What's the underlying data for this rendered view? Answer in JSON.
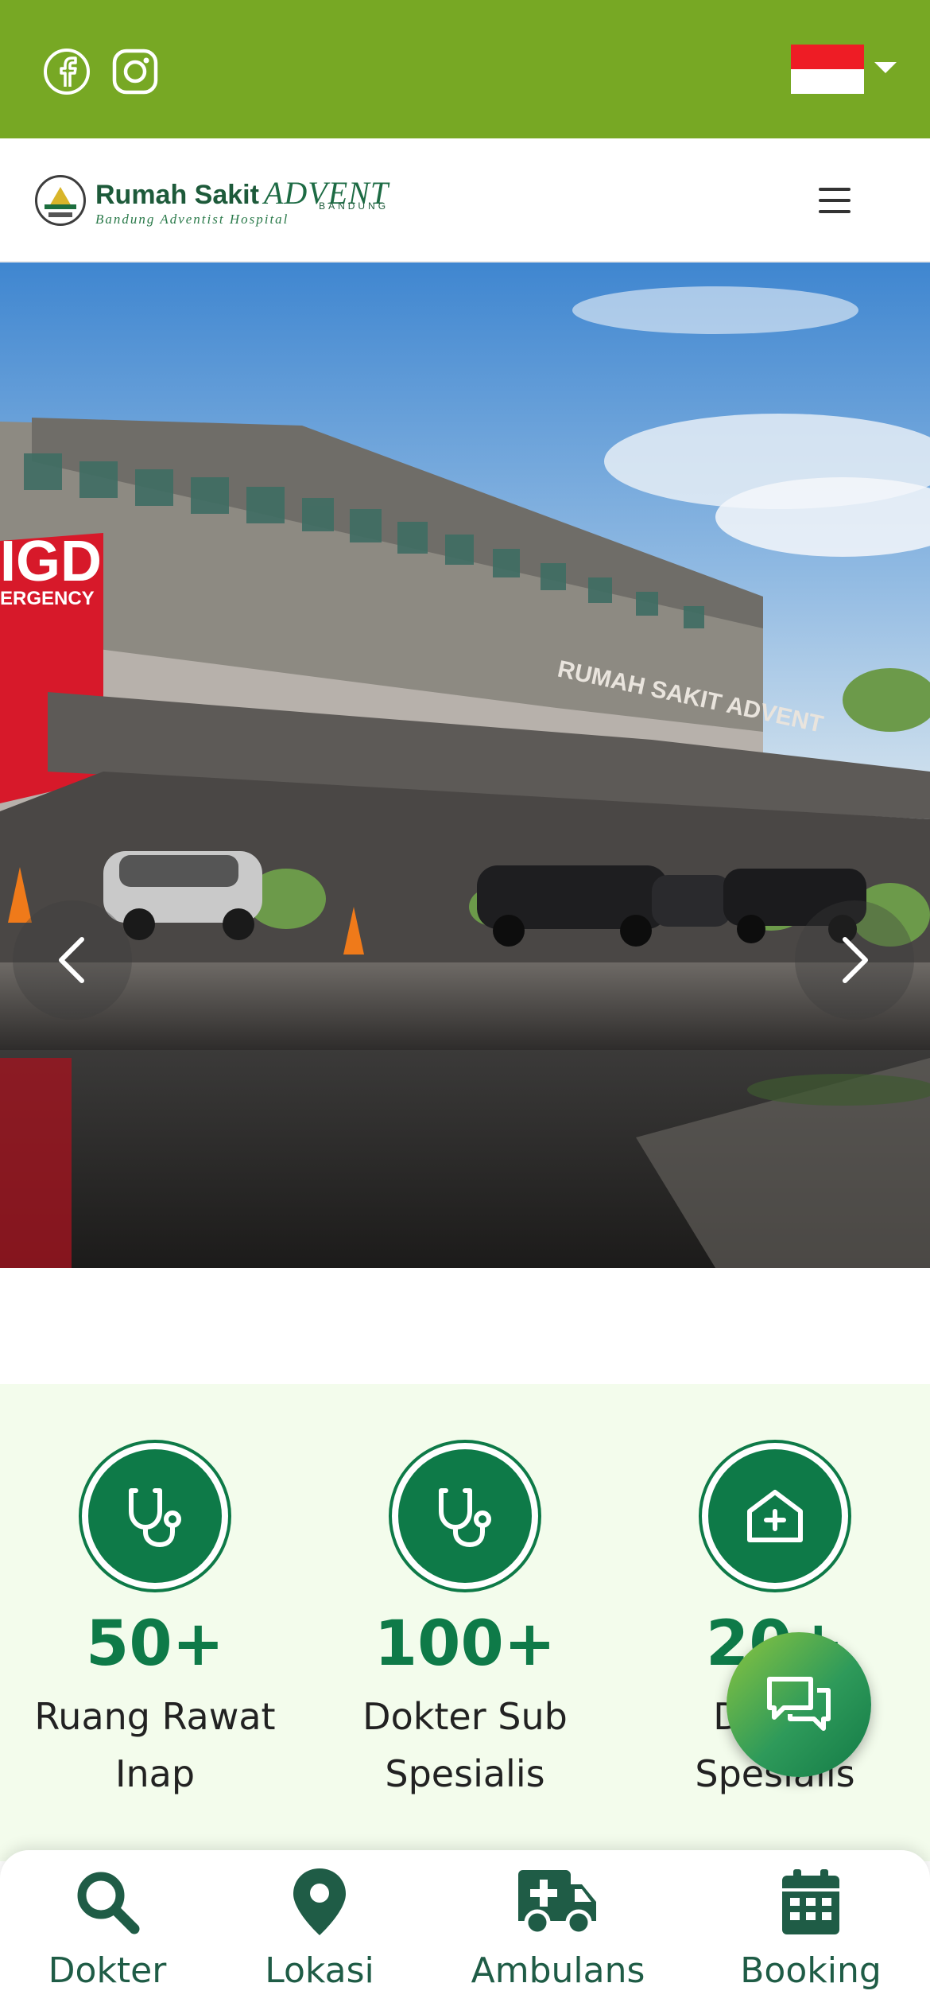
{
  "topbar": {
    "social": [
      {
        "icon": "facebook-icon"
      },
      {
        "icon": "instagram-icon"
      }
    ],
    "language": {
      "flag": "indonesia-flag",
      "colors": [
        "#ee1c25",
        "#ffffff"
      ]
    }
  },
  "header": {
    "logo": {
      "name_main": "Rumah Sakit",
      "name_accent": "ADVENT",
      "city": "BANDUNG",
      "tagline": "Bandung Adventist Hospital"
    },
    "menu_icon": "hamburger-icon"
  },
  "hero": {
    "slides_count": 3,
    "active_slide": 1,
    "sign_text": "RUMAH SAKIT ADVENT",
    "emergency_sign": "IGD",
    "emergency_sub": "ERGENCY"
  },
  "stats": [
    {
      "number": "50+",
      "label": "Ruang Rawat Inap",
      "icon": "stethoscope-icon"
    },
    {
      "number": "100+",
      "label": "Dokter Sub Spesialis",
      "icon": "stethoscope-icon"
    },
    {
      "number": "20+",
      "label": "Dokter Spesialis",
      "icon": "clinic-icon"
    }
  ],
  "chat": {
    "icon": "chat-icon"
  },
  "bottom_nav": [
    {
      "label": "Dokter",
      "icon": "search-icon"
    },
    {
      "label": "Lokasi",
      "icon": "location-pin-icon"
    },
    {
      "label": "Ambulans",
      "icon": "ambulance-icon"
    },
    {
      "label": "Booking",
      "icon": "calendar-icon"
    }
  ],
  "colors": {
    "topbar": "#77a824",
    "primary": "#0e7a48",
    "stats_bg": "#f3fcec",
    "nav_text": "#1f5c46"
  }
}
